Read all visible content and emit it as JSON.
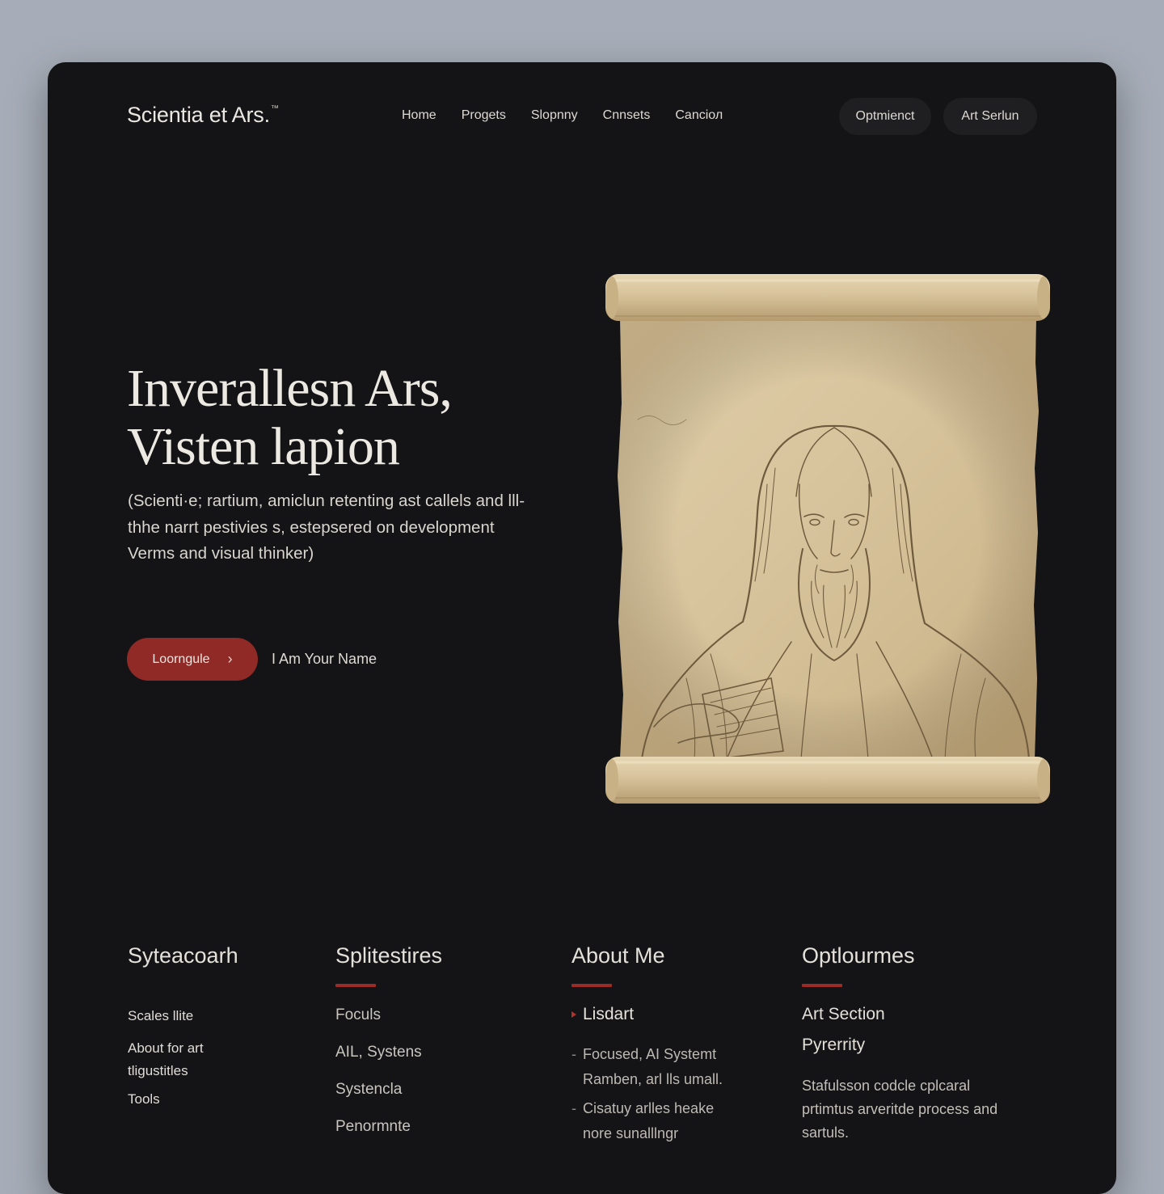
{
  "header": {
    "brand": "Scientia et Ars.",
    "brand_mark": "™",
    "nav": [
      "Home",
      "Progets",
      "Slopnny",
      "Cnnsets",
      "Canciол"
    ],
    "buttons": [
      "Optmienct",
      "Art Serlun"
    ]
  },
  "hero": {
    "title_line1": "Inverallesn Ars,",
    "title_line2": "Visten lapion",
    "description": "(Scienti·e; rartium, amiclun retenting ast callels and lll-thhe narrt pestivies s, estepsered on development Verms and visual thinker)",
    "cta_label": "Loorngule",
    "cta_icon": "chevron-right-icon",
    "secondary_label": "I Am Your Name",
    "artwork": "parchment-scroll-portrait"
  },
  "columns": {
    "col1": {
      "title": "Syteacoarh",
      "items": [
        "Scales llite",
        "About for art tligustitles",
        "Tools"
      ]
    },
    "col2": {
      "title": "Splitestires",
      "items": [
        "Foculs",
        "AIL, Systens",
        "Systencla",
        "Penormnte"
      ]
    },
    "col3": {
      "title": "About Me",
      "heading": "Lisdart",
      "items": [
        "Focused, AI Systemt Ramben, arl lls umall.",
        "Cisatuy arlles heake nore sunalllngr"
      ]
    },
    "col4": {
      "title": "Optlourmes",
      "items": [
        "Art Section",
        "Pyrerrity"
      ],
      "text": "Stafulsson codcle cplcaral prtimtus arveritde process and sartuls."
    }
  },
  "colors": {
    "accent": "#8f2a26",
    "panel": "#141416",
    "backdrop": "#a7adb8",
    "parchment": "#d9c6a0"
  }
}
